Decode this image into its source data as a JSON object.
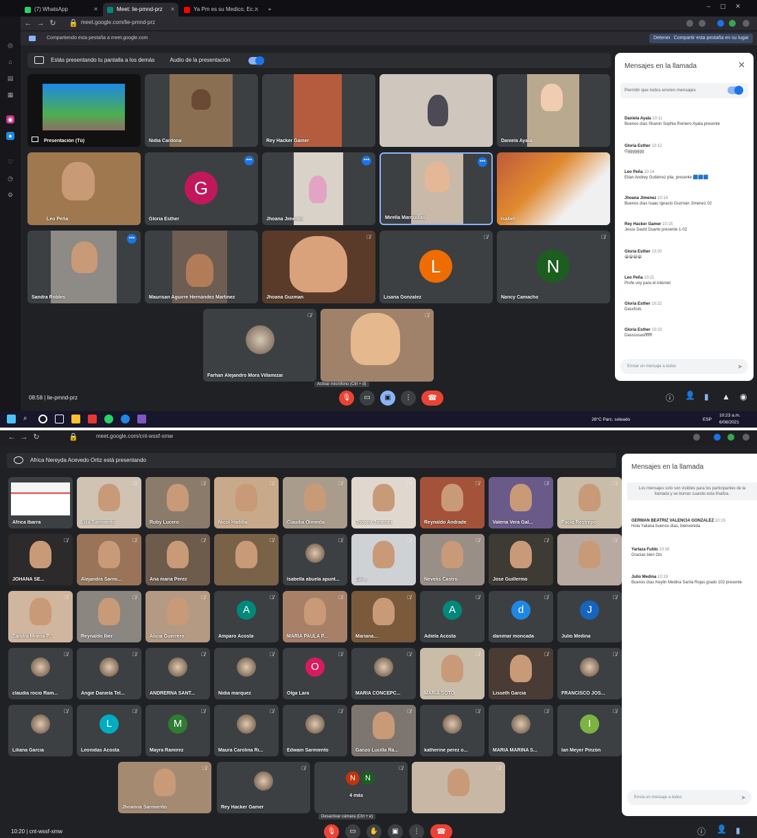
{
  "screenshot_1": {
    "browser": {
      "tabs": [
        {
          "label": "(7) WhatsApp",
          "fav_color": "#25d366"
        },
        {
          "label": "Meet: lie-pmnd-prz",
          "fav_color": "#00897b"
        },
        {
          "label": "Ya Pm es su Medico, Ec…",
          "fav_color": "#ff0000"
        }
      ],
      "url": "meet.google.com/lie-pmnd-prz",
      "share_notice": "Compartiendo esta pestaña a meet.google.com",
      "stop_label": "Detener",
      "share_here_label": "Compartir esta pestaña en su lugar"
    },
    "presenting_bar": {
      "text": "Estás presentando tu pantalla a los demás",
      "audio_label": "Audio de la presentación"
    },
    "tiles": [
      {
        "name": "Presentación (Tú)",
        "type": "presentation"
      },
      {
        "name": "Nidia Cardona",
        "type": "video",
        "bg": "#8a6f52"
      },
      {
        "name": "Rey Hacker Gamer",
        "type": "video",
        "bg": "#b65c3e"
      },
      {
        "name": "",
        "type": "video",
        "bg": "#cfc7bd"
      },
      {
        "name": "Daniela Ayala",
        "type": "video",
        "bg": "#b9a98e"
      },
      {
        "name": "Leo Peña",
        "type": "video",
        "bg": "#a07850"
      },
      {
        "name": "Gloria Esther",
        "type": "avatar",
        "letter": "G",
        "color": "#c2185b"
      },
      {
        "name": "Jhoana Jimenez",
        "type": "video",
        "bg": "#d9d2c8"
      },
      {
        "name": "Mirella Marquillas",
        "type": "video",
        "bg": "#c9b9a8"
      },
      {
        "name": "Isabel",
        "type": "video",
        "bg": "#bf5a3a"
      },
      {
        "name": "Sandra Robles",
        "type": "video",
        "bg": "#8e8a86"
      },
      {
        "name": "Maurisan Aguirre Hernández Martinez",
        "type": "video",
        "bg": "#6e5d52"
      },
      {
        "name": "Jhoana Guzman",
        "type": "video",
        "bg": "#5a3b2a"
      },
      {
        "name": "Lisana Gonzalez",
        "type": "avatar",
        "letter": "L",
        "color": "#ef6c00"
      },
      {
        "name": "Nancy Camacho",
        "type": "avatar",
        "letter": "N",
        "color": "#1b5e20"
      },
      {
        "name": "Farhan Alejandro Mora Villamizar",
        "type": "photo",
        "bg": "#3c4043"
      },
      {
        "name": "",
        "type": "video",
        "bg": "#a0826a"
      }
    ],
    "hover_tip": "Activar micrófono (Ctrl + d)",
    "bottom": {
      "time": "08:58",
      "code": "lie-pmnd-prz"
    },
    "chat": {
      "title": "Mensajes en la llamada",
      "setting": "Permitir que todos envíen mensajes",
      "messages": [
        {
          "who": "Daniela Ayala",
          "time": "10:11",
          "text": "Buenos días Sharon Sophia Romero Ayala presente"
        },
        {
          "who": "Gloria Esther",
          "time": "10:12",
          "text": "Gggggggg"
        },
        {
          "who": "Leo Peña",
          "time": "10:14",
          "text": "Eitan Andrey Gutiérrez pila. presente 🟦🟦🟦"
        },
        {
          "who": "Jhoana Jimenez",
          "time": "10:14",
          "text": "Buenos días Isaac Ignacio Guzmán Jimenez 02"
        },
        {
          "who": "Rey Hacker Gamer",
          "time": "10:15",
          "text": "Jesús David Duarte presente 1-02"
        },
        {
          "who": "Gloria Esther",
          "time": "10:20",
          "text": "😀😀😀😀"
        },
        {
          "who": "Leo Peña",
          "time": "10:21",
          "text": "Profe voy para el internet"
        },
        {
          "who": "Gloria Esther",
          "time": "10:22",
          "text": "Dasxfcds"
        },
        {
          "who": "Gloria Esther",
          "time": "10:23",
          "text": "Dasssssasfffffff"
        }
      ],
      "input_placeholder": "Enviar un mensaje a todos"
    },
    "taskbar": {
      "weather": "28°C Parc. soleado",
      "lang": "ESP",
      "clock": "10:23 a.m.",
      "date": "6/08/2021"
    }
  },
  "screenshot_2": {
    "browser": {
      "url": "meet.google.com/cnt-wssf-xmw"
    },
    "presenting_bar": {
      "text": "Africa Nereyda Acevedo Ortiz está presentando"
    },
    "tiles": [
      {
        "name": "África Ibarra",
        "type": "presentation"
      },
      {
        "name": "Liza Sarmiento",
        "type": "video",
        "bg": "#d1c3b4"
      },
      {
        "name": "Ruby Lucero",
        "type": "video",
        "bg": "#8b7b6b"
      },
      {
        "name": "Nicol Hadilla",
        "type": "video",
        "bg": "#c8a98a"
      },
      {
        "name": "Claudia Olmeida",
        "type": "video",
        "bg": "#a99c8c"
      },
      {
        "name": "Jhoana Jimenez",
        "type": "video",
        "bg": "#e0d8ce"
      },
      {
        "name": "Reynaldo Andrade",
        "type": "video",
        "bg": "#a5523a"
      },
      {
        "name": "Valeria Vera Gal...",
        "type": "video",
        "bg": "#6a5a8a"
      },
      {
        "name": "Paola Restrepo",
        "type": "video",
        "bg": "#c9bca9"
      },
      {
        "name": "JOHANA SE...",
        "type": "video",
        "bg": "#2c2a2a"
      },
      {
        "name": "Alejandra Sarmi...",
        "type": "video",
        "bg": "#9a7458"
      },
      {
        "name": "Ana maria Perez",
        "type": "video",
        "bg": "#6d5b4c"
      },
      {
        "name": "",
        "type": "video",
        "bg": "#7a6248"
      },
      {
        "name": "Isabella abuela apunt...",
        "type": "avatar-photo",
        "bg": "#3c4043"
      },
      {
        "name": "Lili ...",
        "type": "video",
        "bg": "#cfd2d4"
      },
      {
        "name": "Nevelis Castro",
        "type": "video",
        "bg": "#9a8f86"
      },
      {
        "name": "Jose Guillermo",
        "type": "video",
        "bg": "#3e3a34"
      },
      {
        "name": "",
        "type": "video",
        "bg": "#b8aaa0"
      },
      {
        "name": "Sandra Milena P...",
        "type": "video",
        "bg": "#d0b69e"
      },
      {
        "name": "Reynaldo Iber",
        "type": "video",
        "bg": "#8c8680"
      },
      {
        "name": "Alicia Guerrero",
        "type": "video",
        "bg": "#b49a83"
      },
      {
        "name": "Amparo Acosta",
        "type": "avatar",
        "letter": "A",
        "color": "#00897b"
      },
      {
        "name": "MARIA PAULA P...",
        "type": "video",
        "bg": "#a88068"
      },
      {
        "name": "Mariana...",
        "type": "video",
        "bg": "#7a5a3a"
      },
      {
        "name": "Adiela Acosta",
        "type": "avatar",
        "letter": "A",
        "color": "#00897b"
      },
      {
        "name": "danimar moncada",
        "type": "avatar",
        "letter": "d",
        "color": "#1e88e5"
      },
      {
        "name": "Julio Medina",
        "type": "avatar",
        "letter": "J",
        "color": "#1565c0"
      },
      {
        "name": "claudia rocio Ram...",
        "type": "avatar-photo",
        "bg": "#3c4043"
      },
      {
        "name": "Angie Daniela Tel...",
        "type": "avatar-photo",
        "bg": "#3c4043"
      },
      {
        "name": "ANDRERNA SANT...",
        "type": "avatar-photo",
        "bg": "#3c4043"
      },
      {
        "name": "Nidia marquez",
        "type": "avatar-photo",
        "bg": "#3c4043"
      },
      {
        "name": "Olga Lara",
        "type": "avatar",
        "letter": "O",
        "color": "#d81b60"
      },
      {
        "name": "MARIA CONCEPC...",
        "type": "avatar-photo",
        "bg": "#3c4043"
      },
      {
        "name": "MARIA SOTO",
        "type": "video",
        "bg": "#c9bca8"
      },
      {
        "name": "Lisseth Garcia",
        "type": "video",
        "bg": "#4a3c34"
      },
      {
        "name": "FRANCISCO JOS...",
        "type": "avatar-photo",
        "bg": "#3c4043"
      },
      {
        "name": "Liliana Garcia",
        "type": "avatar-photo",
        "bg": "#3c4043"
      },
      {
        "name": "Leonidas Acosta",
        "type": "avatar",
        "letter": "L",
        "color": "#00acc1"
      },
      {
        "name": "Mayra Ramirez",
        "type": "avatar",
        "letter": "M",
        "color": "#2e7d32"
      },
      {
        "name": "Maura Carolina Ri...",
        "type": "avatar-photo",
        "bg": "#3c4043"
      },
      {
        "name": "Edwain Sarmiento",
        "type": "avatar-photo",
        "bg": "#3c4043"
      },
      {
        "name": "Ganzo Lucilla Ra...",
        "type": "video",
        "bg": "#7d7670"
      },
      {
        "name": "katherine perez o...",
        "type": "avatar-photo",
        "bg": "#3c4043"
      },
      {
        "name": "MARIA MARINA S...",
        "type": "avatar-photo",
        "bg": "#3c4043"
      },
      {
        "name": "Ian Meyer Pinzón",
        "type": "avatar",
        "letter": "I",
        "color": "#7cb342"
      },
      {
        "name": "Jhoanna Sarmiento",
        "type": "video",
        "bg": "#a58a72"
      },
      {
        "name": "Rey Hacker Gamer",
        "type": "avatar-photo",
        "bg": "#3c4043"
      },
      {
        "name": "4 más",
        "type": "more",
        "letters": [
          "N",
          "N"
        ]
      },
      {
        "name": "",
        "type": "video",
        "bg": "#c8b7a5"
      }
    ],
    "hover_tip": "Desactivar cámara (Ctrl + e)",
    "bottom": {
      "time": "10:20",
      "code": "cnt-wssf-xmw"
    },
    "chat": {
      "title": "Mensajes en la llamada",
      "note": "Los mensajes solo son visibles para los participantes de la llamada y se borran cuando esta finaliza.",
      "messages": [
        {
          "who": "GERMAN BEATRIZ VALENCIA GONZALEZ",
          "time": "10:15",
          "text": "Hola Yaliana buenos días, bienvenida"
        },
        {
          "who": "Yarlaza Fuldo",
          "time": "10:16",
          "text": "Gracias bien Gts"
        },
        {
          "who": "Julio Medina",
          "time": "10:19",
          "text": "Buenos días Keylin Medina Sarria Rojas grado 102 presente"
        }
      ],
      "input_placeholder": "Envía un mensaje a todos"
    }
  }
}
